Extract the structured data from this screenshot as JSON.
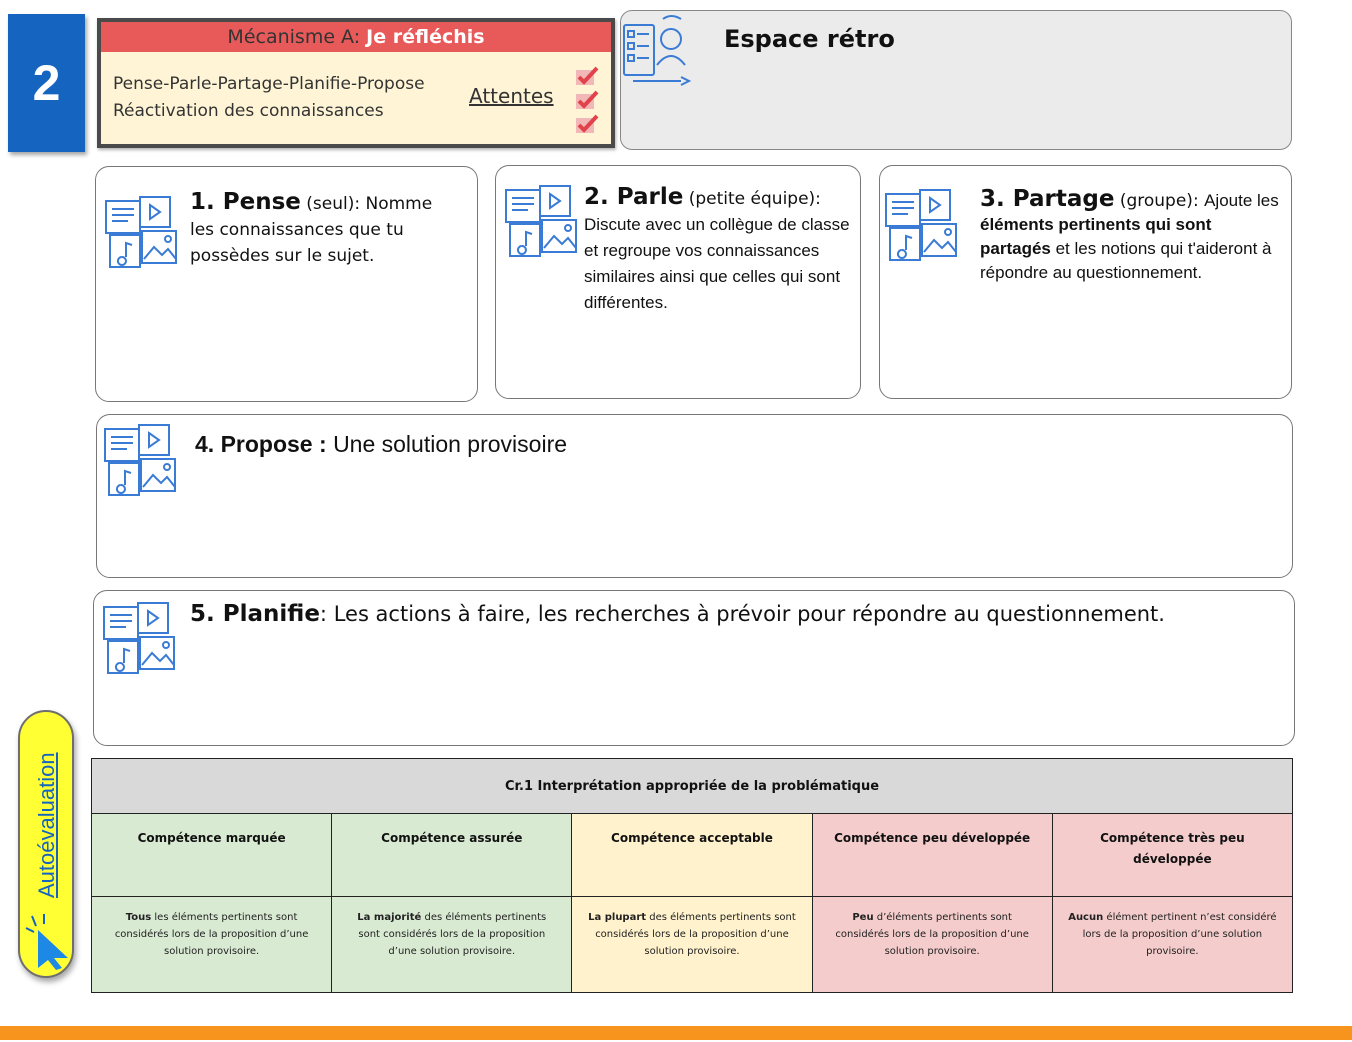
{
  "badge": {
    "number": "2"
  },
  "mechanism": {
    "prefix": "Mécanisme A: ",
    "highlight": "Je réfléchis",
    "line1": "Pense-Parle-Partage-Planifie-Propose",
    "line2": "Réactivation des connaissances",
    "expectations": "Attentes"
  },
  "retro": {
    "title": "Espace rétro",
    "icon": "teacher-checklist-icon"
  },
  "steps": {
    "pense": {
      "num": "1. Pense",
      "note": " (seul): ",
      "line1": "Nomme",
      "line2": "les connaissances que tu",
      "line3": "possèdes sur le sujet."
    },
    "parle": {
      "num": "2. Parle",
      "note": " (petite équipe):",
      "body": "Discute avec un collègue de classe et regroupe vos connaissances similaires ainsi que celles qui sont différentes."
    },
    "partage": {
      "num": "3. Partage",
      "note": " (groupe): ",
      "lead": "Ajoute les ",
      "bold": "éléments pertinents qui sont partagés",
      "rest": " et les notions qui t'aideront à répondre au questionnement."
    },
    "propose": {
      "num": "4. Propose",
      "sep": " : ",
      "body": "Une solution provisoire"
    },
    "planifie": {
      "num": "5. Planifie",
      "sep": ": ",
      "body": "Les actions à faire, les recherches à prévoir pour répondre au  questionnement."
    }
  },
  "autoevaluation": {
    "label": "Autoévaluation",
    "icon": "cursor-click-icon"
  },
  "rubric": {
    "title": "Cr.1 Interprétation appropriée de la problématique",
    "levels": [
      {
        "label": "Compétence marquée",
        "lead": "Tous",
        "desc": " les éléments pertinents sont considérés lors de la proposition d’une solution provisoire.",
        "color": "#d9ead3"
      },
      {
        "label": "Compétence assurée",
        "lead": "La majorité",
        "desc": " des éléments pertinents sont considérés lors de la proposition d’une solution provisoire.",
        "color": "#d9ead3"
      },
      {
        "label": "Compétence acceptable",
        "lead": "La plupart",
        "desc": " des éléments pertinents sont considérés lors de la proposition d’une solution provisoire.",
        "color": "#fff2cc"
      },
      {
        "label": "Compétence peu développée",
        "lead": "Peu",
        "desc": " d’éléments pertinents sont considérés lors de la proposition d’une solution provisoire.",
        "color": "#f4cccc"
      },
      {
        "label": "Compétence très peu développée",
        "lead": "Aucun",
        "desc": " élément pertinent n’est considéré lors de la proposition d’une solution provisoire.",
        "color": "#f4cccc"
      }
    ]
  },
  "colors": {
    "badge": "#1565c0",
    "banner": "#e85a5a",
    "accent_bar": "#f7941d",
    "icon_blue": "#3a7bd5"
  }
}
